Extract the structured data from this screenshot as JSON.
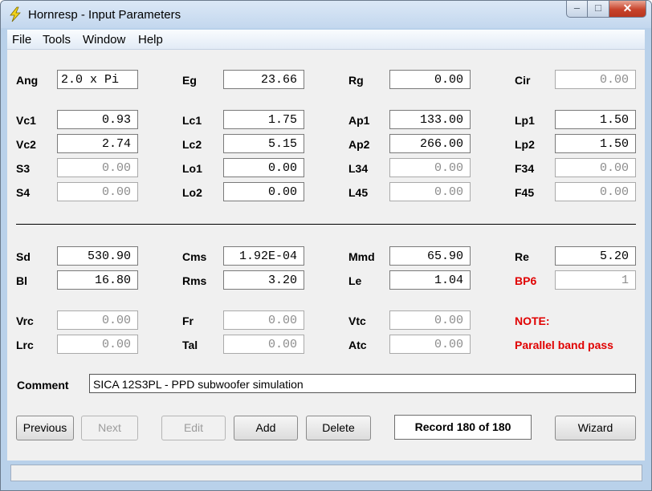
{
  "window": {
    "title": "Hornresp - Input Parameters",
    "minimize_glyph": "–",
    "maximize_glyph": "□",
    "close_glyph": "✕",
    "icon": "lightning-bolt-icon"
  },
  "menu": [
    "File",
    "Tools",
    "Window",
    "Help"
  ],
  "fields": {
    "ang": {
      "label": "Ang",
      "value": "2.0 x Pi"
    },
    "eg": {
      "label": "Eg",
      "value": "23.66"
    },
    "rg": {
      "label": "Rg",
      "value": "0.00"
    },
    "cir": {
      "label": "Cir",
      "value": "0.00"
    },
    "vc1": {
      "label": "Vc1",
      "value": "0.93"
    },
    "lc1": {
      "label": "Lc1",
      "value": "1.75"
    },
    "ap1": {
      "label": "Ap1",
      "value": "133.00"
    },
    "lp1": {
      "label": "Lp1",
      "value": "1.50"
    },
    "vc2": {
      "label": "Vc2",
      "value": "2.74"
    },
    "lc2": {
      "label": "Lc2",
      "value": "5.15"
    },
    "ap2": {
      "label": "Ap2",
      "value": "266.00"
    },
    "lp2": {
      "label": "Lp2",
      "value": "1.50"
    },
    "s3": {
      "label": "S3",
      "value": "0.00"
    },
    "lo1": {
      "label": "Lo1",
      "value": "0.00"
    },
    "l34": {
      "label": "L34",
      "value": "0.00"
    },
    "f34": {
      "label": "F34",
      "value": "0.00"
    },
    "s4": {
      "label": "S4",
      "value": "0.00"
    },
    "lo2": {
      "label": "Lo2",
      "value": "0.00"
    },
    "l45": {
      "label": "L45",
      "value": "0.00"
    },
    "f45": {
      "label": "F45",
      "value": "0.00"
    },
    "sd": {
      "label": "Sd",
      "value": "530.90"
    },
    "cms": {
      "label": "Cms",
      "value": "1.92E-04"
    },
    "mmd": {
      "label": "Mmd",
      "value": "65.90"
    },
    "re": {
      "label": "Re",
      "value": "5.20"
    },
    "bl": {
      "label": "Bl",
      "value": "16.80"
    },
    "rms": {
      "label": "Rms",
      "value": "3.20"
    },
    "le": {
      "label": "Le",
      "value": "1.04"
    },
    "bp6": {
      "label": "BP6",
      "value": "1"
    },
    "vrc": {
      "label": "Vrc",
      "value": "0.00"
    },
    "fr": {
      "label": "Fr",
      "value": "0.00"
    },
    "vtc": {
      "label": "Vtc",
      "value": "0.00"
    },
    "lrc": {
      "label": "Lrc",
      "value": "0.00"
    },
    "tal": {
      "label": "Tal",
      "value": "0.00"
    },
    "atc": {
      "label": "Atc",
      "value": "0.00"
    }
  },
  "note": {
    "label": "NOTE:",
    "text": "Parallel band pass"
  },
  "comment": {
    "label": "Comment",
    "value": "SICA 12S3PL - PPD subwoofer simulation"
  },
  "buttons": {
    "previous": "Previous",
    "next": "Next",
    "edit": "Edit",
    "add": "Add",
    "delete": "Delete",
    "wizard": "Wizard"
  },
  "record": "Record 180 of 180",
  "colors": {
    "accent_red": "#e00000",
    "window_frame": "#b9d1ea"
  }
}
